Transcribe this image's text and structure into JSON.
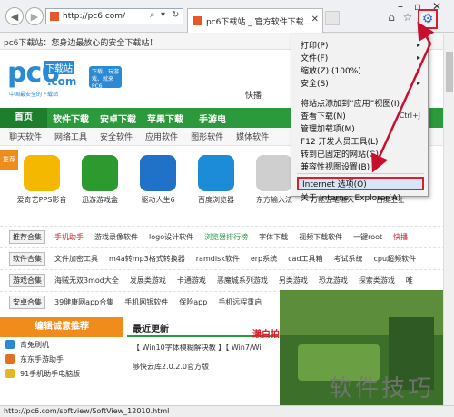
{
  "browser": {
    "address_url": "http://pc6.com/",
    "tab_title": "pc6下载站 _ 官方软件下载...",
    "status_url": "http://pc6.com/softview/SoftView_12010.html"
  },
  "page": {
    "topbar_text": "pc6下载站：您身边最放心的安全下载站！",
    "logo_main": "pc6",
    "logo_badge": "下载站",
    "logo_dot_com": ".com",
    "logo_sub": "中国最安全的下载站",
    "slogan_box": "下载、玩游戏、就来PC6",
    "quick_text": "快播",
    "nav": [
      "首页",
      "软件下载",
      "安卓下载",
      "苹果下载",
      "手游电"
    ],
    "subnav": [
      "聊天软件",
      "网络工具",
      "安全软件",
      "应用软件",
      "图形软件",
      "媒体软件"
    ],
    "apps_badge": "推荐",
    "apps": [
      {
        "label": "爱奇艺PPS影音",
        "color": "#f5b800"
      },
      {
        "label": "迅游游戏盒",
        "color": "#2d9a2f"
      },
      {
        "label": "驱动人生6",
        "color": "#1f72c8"
      },
      {
        "label": "百度浏览器",
        "color": "#1c8bd8"
      },
      {
        "label": "东方输入法",
        "color": "#cfcfcf"
      },
      {
        "label": "万能五笔输入",
        "color": "#dcdcdc"
      },
      {
        "label": "百度卫士",
        "color": "#2a79d0"
      }
    ],
    "tag_rows": [
      {
        "tag": "推荐合集",
        "items": [
          {
            "t": "手机助手",
            "c": "red"
          },
          {
            "t": "游戏录像软件",
            "c": ""
          },
          {
            "t": "logo设计软件",
            "c": ""
          },
          {
            "t": "浏览器排行榜",
            "c": "green"
          },
          {
            "t": "字体下载",
            "c": ""
          },
          {
            "t": "视频下载软件",
            "c": ""
          },
          {
            "t": "一键root",
            "c": ""
          },
          {
            "t": "快播",
            "c": "red"
          }
        ]
      },
      {
        "tag": "软件合集",
        "items": [
          {
            "t": "文件加密工具",
            "c": ""
          },
          {
            "t": "m4a转mp3格式转换器",
            "c": ""
          },
          {
            "t": "ramdisk软件",
            "c": ""
          },
          {
            "t": "erp系统",
            "c": ""
          },
          {
            "t": "cad工具箱",
            "c": ""
          },
          {
            "t": "考试系统",
            "c": ""
          },
          {
            "t": "cpu超频软件",
            "c": ""
          }
        ]
      },
      {
        "tag": "游戏合集",
        "items": [
          {
            "t": "海贼无双3mod大全",
            "c": ""
          },
          {
            "t": "发展类游戏",
            "c": ""
          },
          {
            "t": "卡通游戏",
            "c": ""
          },
          {
            "t": "恶魔城系列游戏",
            "c": ""
          },
          {
            "t": "另类游戏",
            "c": ""
          },
          {
            "t": "恐龙游戏",
            "c": ""
          },
          {
            "t": "探索类游戏",
            "c": ""
          },
          {
            "t": "唯"
          }
        ]
      },
      {
        "tag": "安卓合集",
        "items": [
          {
            "t": "39健康网app合集",
            "c": ""
          },
          {
            "t": "手机网银软件",
            "c": ""
          },
          {
            "t": "保险app",
            "c": ""
          },
          {
            "t": "手机远程重启",
            "c": ""
          }
        ]
      }
    ],
    "left_header": "编辑诚意推荐",
    "left_items": [
      {
        "label": "奇兔刷机",
        "color": "#2b8ad6"
      },
      {
        "label": "东东手游助手",
        "color": "#e46f1e"
      },
      {
        "label": "91手机助手电脑版",
        "color": "#e4b81e"
      }
    ],
    "mid_header": "最近更新",
    "mid_lines": [
      "【 Win10字体模糊解决教 】【 Win7/Wi",
      "够快云库2.0.2.0官方版"
    ],
    "red_text": "瀨白拍"
  },
  "menu": {
    "items": [
      {
        "label": "打印(P)",
        "right": "▸"
      },
      {
        "label": "文件(F)",
        "right": "▸"
      },
      {
        "label": "缩放(Z) (100%)",
        "right": "▸"
      },
      {
        "label": "安全(S)",
        "right": "▸"
      },
      {
        "label": "将站点添加到“应用”视图(I)",
        "right": ""
      },
      {
        "label": "查看下载(N)",
        "right": "Ctrl+J"
      },
      {
        "label": "管理加载项(M)",
        "right": ""
      },
      {
        "label": "F12 开发人员工具(L)",
        "right": ""
      },
      {
        "label": "转到已固定的网站(G)",
        "right": ""
      },
      {
        "label": "兼容性视图设置(B)",
        "right": ""
      },
      {
        "label": "Internet 选项(O)",
        "right": ""
      },
      {
        "label": "关于 Internet Explorer(A)",
        "right": ""
      }
    ]
  },
  "watermark": "软件技巧",
  "colors": {
    "accent_red": "#d8202a",
    "nav_green": "#2b9a3c",
    "orange": "#f08c1c",
    "brand_blue": "#2a8ad4"
  }
}
